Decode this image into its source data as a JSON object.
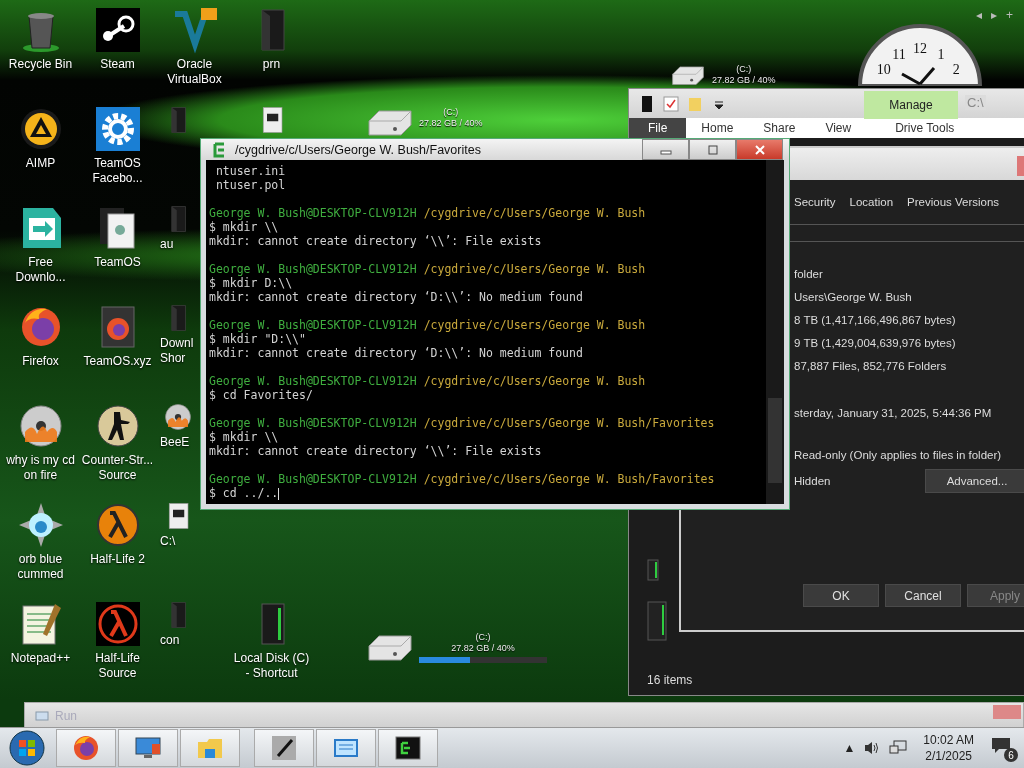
{
  "desktop_icons": [
    [
      {
        "label": "Recycle Bin",
        "kind": "trash"
      },
      {
        "label": "AIMP",
        "kind": "triangle"
      },
      {
        "label": "Free Downlo...",
        "kind": "download"
      },
      {
        "label": "Firefox",
        "kind": "firefox"
      },
      {
        "label": "why is my cd on fire",
        "kind": "disc"
      },
      {
        "label": "orb blue cummed",
        "kind": "orb"
      },
      {
        "label": "Notepad++",
        "kind": "notepad"
      }
    ],
    [
      {
        "label": "Steam",
        "kind": "steam"
      },
      {
        "label": "TeamOS Facebo...",
        "kind": "gear"
      },
      {
        "label": "TeamOS",
        "kind": "document"
      },
      {
        "label": "TeamOS.xyz",
        "kind": "firefox-file"
      },
      {
        "label": "Counter-Str... Source",
        "kind": "soldier"
      },
      {
        "label": "Half-Life 2",
        "kind": "lambda"
      },
      {
        "label": "Half-Life Source",
        "kind": "lambda-red"
      }
    ],
    [
      {
        "label": "Oracle VirtualBox",
        "kind": "box"
      },
      {
        "kind": "dark-file"
      },
      {
        "label": "au",
        "kind": "dark-file"
      },
      {
        "label": "Downl Shor",
        "kind": "dark-file"
      },
      {
        "label": "BeeE",
        "kind": "disc"
      },
      {
        "label": "C:\\",
        "kind": "white-file"
      },
      {
        "label": "con",
        "kind": "dark-file"
      }
    ],
    [
      {
        "label": "prn",
        "kind": "dark-file"
      },
      {
        "kind": "white-file"
      },
      {
        "label": "Local Disk (C) - Shortcut",
        "kind": "tower"
      }
    ]
  ],
  "gadget_controls": [
    "◂",
    "▸",
    "+"
  ],
  "clock": {
    "numerals": [
      "10",
      "11",
      "12",
      "1",
      "2"
    ]
  },
  "drive_gadgets": [
    {
      "drive": "(C:)",
      "usage": "27.82 GB / 40%"
    },
    {
      "drive": "(C:)",
      "usage": "27.82 GB / 40%"
    },
    {
      "drive": "(C:)",
      "usage": "27.82 GB / 40%",
      "level": 0.4
    }
  ],
  "explorer": {
    "title": "C:\\",
    "context_tab": "Manage",
    "ribbon_tabs": [
      {
        "label": "File",
        "selected": true
      },
      {
        "label": "Home",
        "selected": false
      },
      {
        "label": "Share",
        "selected": false
      },
      {
        "label": "View",
        "selected": false
      },
      {
        "label": "Drive Tools",
        "selected": false
      }
    ],
    "status": "16 items",
    "properties": {
      "tabs": [
        "Security",
        "Location",
        "Previous Versions"
      ],
      "info_rows": [
        "folder",
        "Users\\George W. Bush",
        "8 TB (1,417,166,496,867 bytes)",
        "9 TB (1,429,004,639,976 bytes)",
        "87,887 Files, 852,776 Folders",
        "sterday, January 31, 2025, 5:44:36 PM"
      ],
      "attributes": [
        "Read-only (Only applies to files in folder)",
        "Hidden"
      ],
      "advanced_button": "Advanced...",
      "buttons": [
        {
          "label": "OK",
          "disabled": false
        },
        {
          "label": "Cancel",
          "disabled": false
        },
        {
          "label": "Apply",
          "disabled": true
        }
      ]
    }
  },
  "terminal": {
    "title": "/cygdrive/c/Users/George W. Bush/Favorites",
    "blocks": [
      [
        {
          "kind": "listing",
          "text": "ntuser.ini"
        },
        {
          "kind": "listing",
          "text": "ntuser.pol"
        }
      ],
      [
        {
          "kind": "prompt",
          "user": "George W. Bush@DESKTOP-CLV912H",
          "path": "/cygdrive/c/Users/George W. Bush"
        },
        {
          "kind": "command",
          "text": "$ mkdir \\\\"
        },
        {
          "kind": "output",
          "text": "mkdir: cannot create directory ‘\\\\’: File exists"
        }
      ],
      [
        {
          "kind": "prompt",
          "user": "George W. Bush@DESKTOP-CLV912H",
          "path": "/cygdrive/c/Users/George W. Bush"
        },
        {
          "kind": "command",
          "text": "$ mkdir D:\\\\"
        },
        {
          "kind": "output",
          "text": "mkdir: cannot create directory ‘D:\\\\’: No medium found"
        }
      ],
      [
        {
          "kind": "prompt",
          "user": "George W. Bush@DESKTOP-CLV912H",
          "path": "/cygdrive/c/Users/George W. Bush"
        },
        {
          "kind": "command",
          "text": "$ mkdir \"D:\\\\\""
        },
        {
          "kind": "output",
          "text": "mkdir: cannot create directory ‘D:\\\\’: No medium found"
        }
      ],
      [
        {
          "kind": "prompt",
          "user": "George W. Bush@DESKTOP-CLV912H",
          "path": "/cygdrive/c/Users/George W. Bush"
        },
        {
          "kind": "command",
          "text": "$ cd Favorites/"
        }
      ],
      [
        {
          "kind": "prompt",
          "user": "George W. Bush@DESKTOP-CLV912H",
          "path": "/cygdrive/c/Users/George W. Bush/Favorites"
        },
        {
          "kind": "command",
          "text": "$ mkdir \\\\"
        },
        {
          "kind": "output",
          "text": "mkdir: cannot create directory ‘\\\\’: File exists"
        }
      ],
      [
        {
          "kind": "prompt",
          "user": "George W. Bush@DESKTOP-CLV912H",
          "path": "/cygdrive/c/Users/George W. Bush/Favorites"
        },
        {
          "kind": "command",
          "text": "$ cd ../..",
          "cursor": true
        }
      ]
    ]
  },
  "run_window": {
    "title": "Run"
  },
  "taskbar": {
    "items": [
      {
        "kind": "firefox"
      },
      {
        "kind": "computer"
      },
      {
        "kind": "folder"
      },
      {
        "kind": "pen"
      },
      {
        "kind": "window"
      },
      {
        "kind": "terminal"
      }
    ],
    "tray": {
      "overflow": "▲",
      "time": "10:02 AM",
      "date": "2/1/2025",
      "notifications": "6"
    }
  }
}
